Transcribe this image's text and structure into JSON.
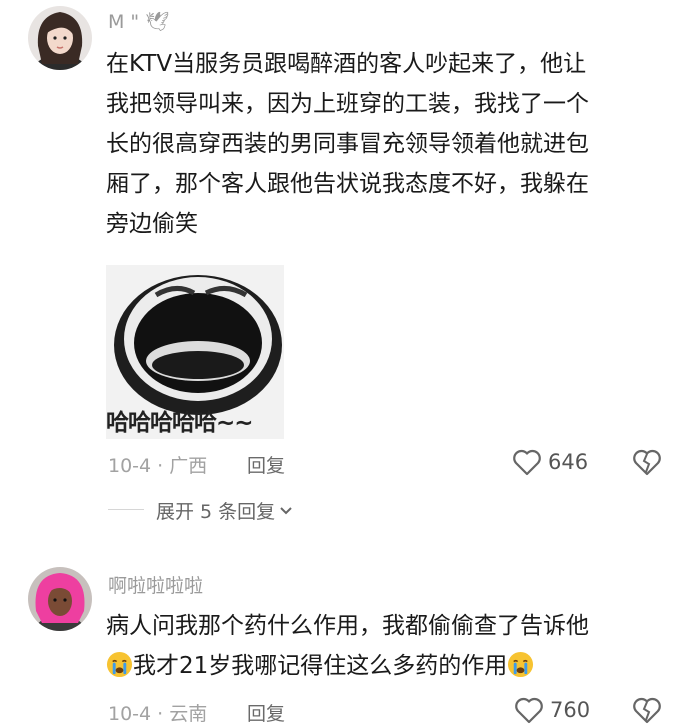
{
  "comments": [
    {
      "username": "M \" 🕊",
      "lines": [
        "在KTV当服务员跟喝醉酒的客人吵起来了，他让",
        "我把领导叫来，因为上班穿的工装，我找了一个",
        "长的很高穿西装的男同事冒充领导领着他就进包",
        "厢了，那个客人跟他告状说我态度不好，我躲在",
        "旁边偷笑"
      ],
      "image_caption": "哈哈哈哈哈~~",
      "date_location": "10-4 · 广西",
      "reply_label": "回复",
      "likes": "646",
      "expand_label": "展开 5 条回复"
    },
    {
      "username": "啊啦啦啦啦",
      "line1": "病人问我那个药什么作用，我都偷偷查了告诉他",
      "line2": "我才21岁我哪记得住这么多药的作用",
      "line2_emoji": "crying-face-icon",
      "date_location": "10-4 · 云南",
      "reply_label": "回复",
      "likes": "760"
    }
  ],
  "colors": {
    "text": "#1a1a1a",
    "muted": "#a2a2a2",
    "icon": "#666666",
    "emoji_yellow": "#f7c331",
    "emoji_tear": "#3d9be9"
  }
}
